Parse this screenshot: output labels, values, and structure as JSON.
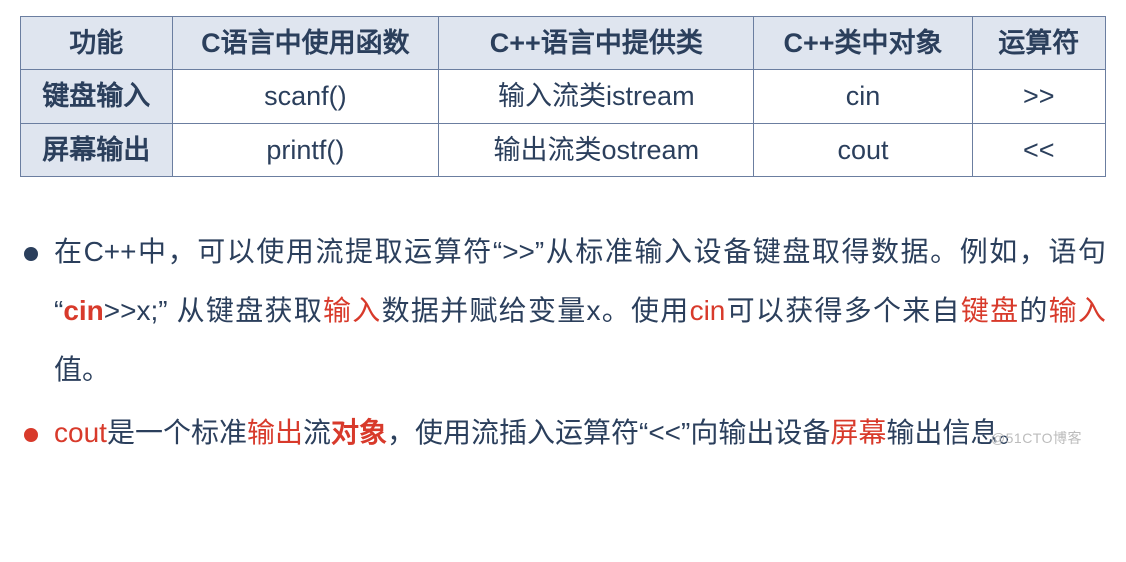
{
  "table": {
    "headers": [
      "功能",
      "C语言中使用函数",
      "C++语言中提供类",
      "C++类中对象",
      "运算符"
    ],
    "rows": [
      {
        "label": "键盘输入",
        "cfunc": "scanf()",
        "cppcls": "输入流类istream",
        "cppobj": "cin",
        "op": ">>"
      },
      {
        "label": "屏幕输出",
        "cfunc": "printf()",
        "cppcls": "输出流类ostream",
        "cppobj": "cout",
        "op": "<<"
      }
    ]
  },
  "bullets": {
    "b1": {
      "t1": "在C++中，可以使用流提取运算符“>>”从标准输入设备键盘取得数据。例如，语句 “",
      "cin": "cin",
      "t2": ">>x;” 从键盘获取",
      "input1": "输入",
      "t3": "数据并赋给变量x。使用",
      "cin2": "cin",
      "t4": "可以获得多个来自",
      "kb": "键盘",
      "t5": "的",
      "input2": "输入",
      "t6": "值。"
    },
    "b2": {
      "cout": "cout",
      "t1": "是一个标准",
      "out": "输出",
      "t2": "流",
      "obj": "对象",
      "t3": "，使用流插入运算符“<<”向输出设备",
      "screen": "屏幕",
      "t4": "输出信息。"
    }
  },
  "watermark": "@51CTO博客"
}
